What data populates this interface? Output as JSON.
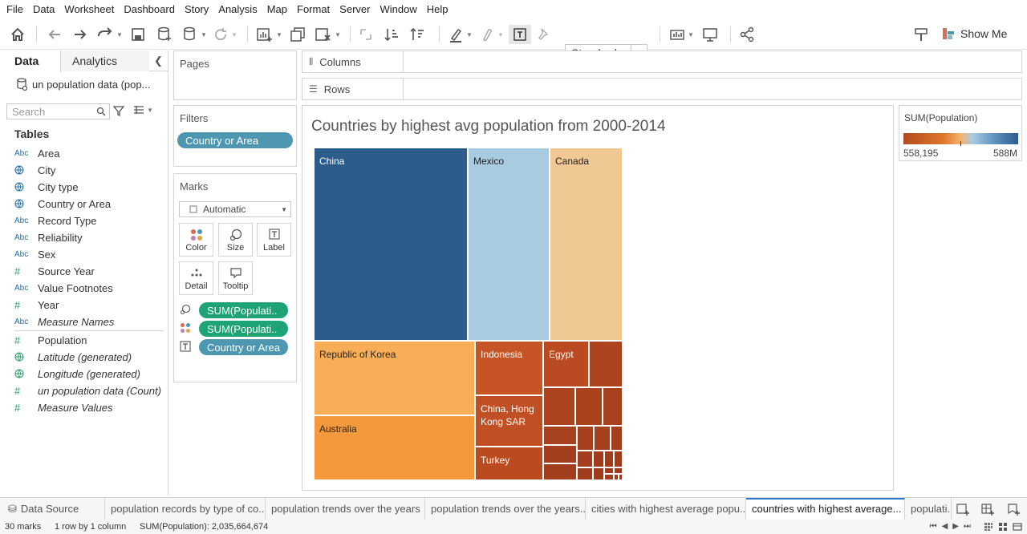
{
  "menu": [
    "File",
    "Data",
    "Worksheet",
    "Dashboard",
    "Story",
    "Analysis",
    "Map",
    "Format",
    "Server",
    "Window",
    "Help"
  ],
  "toolbar": {
    "fit_select": "Standard",
    "show_me": "Show Me"
  },
  "data_pane": {
    "tab_data": "Data",
    "tab_analytics": "Analytics",
    "datasource": "un population data (pop...",
    "search_placeholder": "Search",
    "tables_title": "Tables",
    "dimensions": [
      {
        "type": "Abc",
        "label": "Area"
      },
      {
        "type": "globe",
        "label": "City"
      },
      {
        "type": "globe",
        "label": "City type"
      },
      {
        "type": "globe",
        "label": "Country or Area"
      },
      {
        "type": "Abc",
        "label": "Record Type"
      },
      {
        "type": "Abc",
        "label": "Reliability"
      },
      {
        "type": "Abc",
        "label": "Sex"
      },
      {
        "type": "#",
        "label": "Source Year"
      },
      {
        "type": "Abc",
        "label": "Value Footnotes"
      },
      {
        "type": "#",
        "label": "Year"
      },
      {
        "type": "Abc",
        "label": "Measure Names"
      }
    ],
    "measures": [
      {
        "type": "#",
        "label": "Population"
      },
      {
        "type": "globe",
        "label": "Latitude (generated)"
      },
      {
        "type": "globe",
        "label": "Longitude (generated)"
      },
      {
        "type": "#",
        "label": "un population data (Count)"
      },
      {
        "type": "#",
        "label": "Measure Values"
      }
    ]
  },
  "cards": {
    "pages": "Pages",
    "filters": "Filters",
    "filter_pill": "Country or Area",
    "marks": "Marks",
    "mark_type": "Automatic",
    "buttons": {
      "color": "Color",
      "size": "Size",
      "label": "Label",
      "detail": "Detail",
      "tooltip": "Tooltip"
    },
    "mark_pills": [
      "SUM(Populati..",
      "SUM(Populati..",
      "Country or Area"
    ]
  },
  "shelves": {
    "columns": "Columns",
    "rows": "Rows"
  },
  "viz": {
    "title": "Countries by highest avg population from 2000-2014"
  },
  "chart_data": {
    "type": "treemap",
    "measure": "SUM(Population)",
    "labeled_tiles": [
      "China",
      "Mexico",
      "Canada",
      "Republic of Korea",
      "Australia",
      "Indonesia",
      "Egypt",
      "China, Hong Kong SAR",
      "Turkey"
    ],
    "tile_count": 30
  },
  "legend": {
    "title": "SUM(Population)",
    "min_label": "558,195",
    "max_label": "588M",
    "colors": [
      "#b34a1f",
      "#e0772c",
      "#f5b26b",
      "#a9cbe0",
      "#5d8fbf",
      "#2d5c8c"
    ]
  },
  "sheet_tabs": {
    "datasource": "Data Source",
    "tabs": [
      "population records by type of co...",
      "population trends over the years",
      "population trends over the years...",
      "cities with highest average popu...",
      "countries with highest average...",
      "populati..."
    ],
    "active_index": 4
  },
  "status": {
    "marks": "30 marks",
    "rows_cols": "1 row by 1 column",
    "sum": "SUM(Population): 2,035,664,674"
  }
}
